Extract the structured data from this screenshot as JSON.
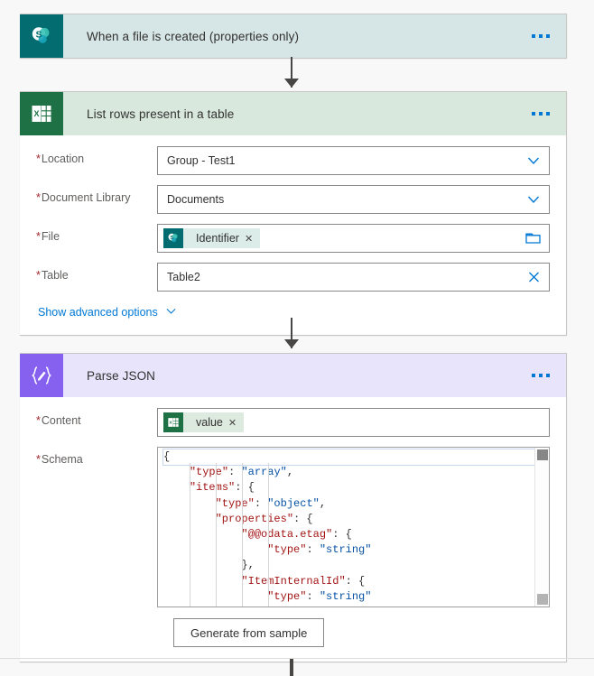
{
  "flow": {
    "trigger": {
      "title": "When a file is created (properties only)",
      "icon": "sharepoint-icon",
      "menu": "more-options"
    },
    "actions": [
      {
        "id": "list-rows",
        "title": "List rows present in a table",
        "icon": "excel-icon",
        "fields": [
          {
            "label": "Location",
            "required": true,
            "value": "Group - Test1",
            "control": "dropdown"
          },
          {
            "label": "Document Library",
            "required": true,
            "value": "Documents",
            "control": "dropdown"
          },
          {
            "label": "File",
            "required": true,
            "token": "Identifier",
            "control": "file-picker"
          },
          {
            "label": "Table",
            "required": true,
            "value": "Table2",
            "control": "clearable"
          }
        ],
        "advanced_link": "Show advanced options"
      },
      {
        "id": "parse-json",
        "title": "Parse JSON",
        "icon": "json-icon",
        "content_field": {
          "label": "Content",
          "required": true,
          "token": "value"
        },
        "schema_field": {
          "label": "Schema",
          "required": true
        },
        "generate_button": "Generate from sample"
      }
    ]
  },
  "schema_code": [
    {
      "indent": 0,
      "parts": [
        {
          "t": "{",
          "c": "p"
        }
      ]
    },
    {
      "indent": 1,
      "parts": [
        {
          "t": "\"type\"",
          "c": "k"
        },
        {
          "t": ": ",
          "c": "p"
        },
        {
          "t": "\"array\"",
          "c": "v"
        },
        {
          "t": ",",
          "c": "p"
        }
      ]
    },
    {
      "indent": 1,
      "parts": [
        {
          "t": "\"items\"",
          "c": "k"
        },
        {
          "t": ": {",
          "c": "p"
        }
      ]
    },
    {
      "indent": 2,
      "parts": [
        {
          "t": "\"type\"",
          "c": "k"
        },
        {
          "t": ": ",
          "c": "p"
        },
        {
          "t": "\"object\"",
          "c": "v"
        },
        {
          "t": ",",
          "c": "p"
        }
      ]
    },
    {
      "indent": 2,
      "parts": [
        {
          "t": "\"properties\"",
          "c": "k"
        },
        {
          "t": ": {",
          "c": "p"
        }
      ]
    },
    {
      "indent": 3,
      "parts": [
        {
          "t": "\"@@odata.etag\"",
          "c": "k"
        },
        {
          "t": ": {",
          "c": "p"
        }
      ]
    },
    {
      "indent": 4,
      "parts": [
        {
          "t": "\"type\"",
          "c": "k"
        },
        {
          "t": ": ",
          "c": "p"
        },
        {
          "t": "\"string\"",
          "c": "v"
        }
      ]
    },
    {
      "indent": 3,
      "parts": [
        {
          "t": "},",
          "c": "p"
        }
      ]
    },
    {
      "indent": 3,
      "parts": [
        {
          "t": "\"ItemInternalId\"",
          "c": "k"
        },
        {
          "t": ": {",
          "c": "p"
        }
      ]
    },
    {
      "indent": 4,
      "parts": [
        {
          "t": "\"type\"",
          "c": "k"
        },
        {
          "t": ": ",
          "c": "p"
        },
        {
          "t": "\"string\"",
          "c": "v"
        }
      ]
    }
  ],
  "colors": {
    "sharepoint": "#036c70",
    "excel": "#1e7145",
    "json": "#8661f0",
    "accent": "#0078d4",
    "required": "#a4262c",
    "connector": "#484644"
  }
}
